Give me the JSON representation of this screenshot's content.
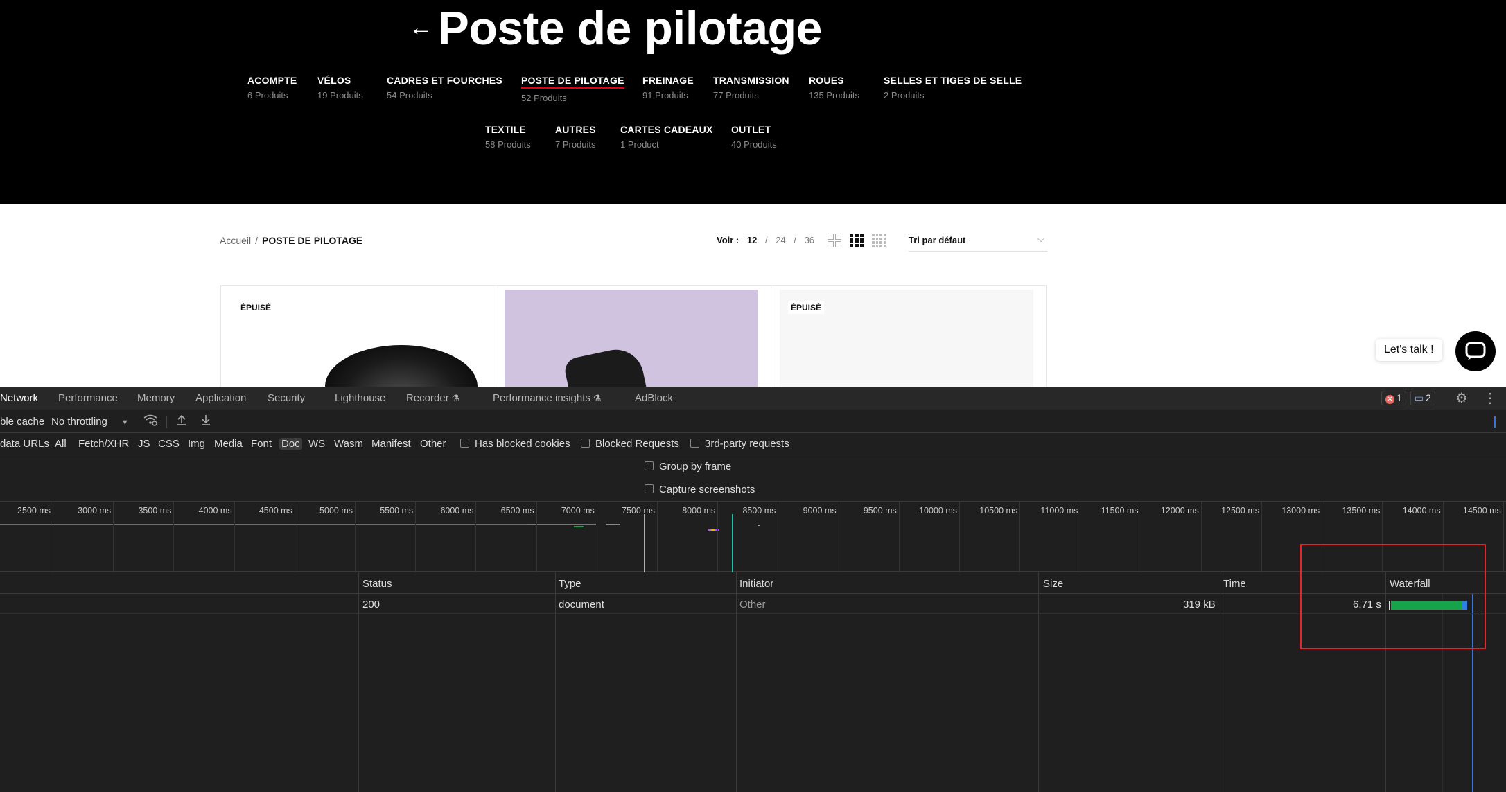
{
  "hero": {
    "back_arrow": "←",
    "title": "Poste de pilotage"
  },
  "categories": [
    {
      "name": "ACOMPTE",
      "count": "6 Produits",
      "active": false
    },
    {
      "name": "VÉLOS",
      "count": "19 Produits",
      "active": false
    },
    {
      "name": "CADRES ET FOURCHES",
      "count": "54 Produits",
      "active": false
    },
    {
      "name": "POSTE DE PILOTAGE",
      "count": "52 Produits",
      "active": true
    },
    {
      "name": "FREINAGE",
      "count": "91 Produits",
      "active": false
    },
    {
      "name": "TRANSMISSION",
      "count": "77 Produits",
      "active": false
    },
    {
      "name": "ROUES",
      "count": "135 Produits",
      "active": false
    },
    {
      "name": "SELLES ET TIGES DE SELLE",
      "count": "2 Produits",
      "active": false
    },
    {
      "name": "TEXTILE",
      "count": "58 Produits",
      "active": false
    },
    {
      "name": "AUTRES",
      "count": "7 Produits",
      "active": false
    },
    {
      "name": "CARTES CADEAUX",
      "count": "1 Product",
      "active": false
    },
    {
      "name": "OUTLET",
      "count": "40 Produits",
      "active": false
    }
  ],
  "breadcrumb": {
    "home": "Accueil",
    "separator": "/",
    "current": "POSTE DE PILOTAGE"
  },
  "per_page": {
    "label": "Voir :",
    "options": [
      "12",
      "24",
      "36"
    ],
    "selected": "12",
    "separator": "/"
  },
  "sort": {
    "value": "Tri par défaut",
    "chevron": "⌵"
  },
  "products": [
    {
      "badge": "ÉPUISÉ"
    },
    {
      "badge": ""
    },
    {
      "badge": "ÉPUISÉ"
    }
  ],
  "chat": {
    "label": "Let's talk !"
  },
  "devtools": {
    "tabs": [
      {
        "label": "Network",
        "active": true
      },
      {
        "label": "Performance",
        "active": false
      },
      {
        "label": "Memory",
        "active": false
      },
      {
        "label": "Application",
        "active": false
      },
      {
        "label": "Security",
        "active": false
      },
      {
        "label": "Lighthouse",
        "active": false
      },
      {
        "label": "Recorder",
        "active": false,
        "flask": true
      },
      {
        "label": "Performance insights",
        "active": false,
        "flask": true
      },
      {
        "label": "AdBlock",
        "active": false
      }
    ],
    "flask_icon": "⚗",
    "errors_count": "1",
    "messages_count": "2",
    "toolbar": {
      "disable_cache": "ble cache",
      "throttling": "No throttling",
      "throttle_arrow": "▼"
    },
    "filters": {
      "data_urls": "data URLs",
      "types": [
        "All",
        "Fetch/XHR",
        "JS",
        "CSS",
        "Img",
        "Media",
        "Font",
        "Doc",
        "WS",
        "Wasm",
        "Manifest",
        "Other"
      ],
      "active_type": "Doc",
      "checkboxes": [
        "Has blocked cookies",
        "Blocked Requests",
        "3rd-party requests"
      ]
    },
    "options": [
      "Group by frame",
      "Capture screenshots"
    ],
    "timeline_ticks": [
      "2500 ms",
      "3000 ms",
      "3500 ms",
      "4000 ms",
      "4500 ms",
      "5000 ms",
      "5500 ms",
      "6000 ms",
      "6500 ms",
      "7000 ms",
      "7500 ms",
      "8000 ms",
      "8500 ms",
      "9000 ms",
      "9500 ms",
      "10000 ms",
      "10500 ms",
      "11000 ms",
      "11500 ms",
      "12000 ms",
      "12500 ms",
      "13000 ms",
      "13500 ms",
      "14000 ms",
      "14500 ms"
    ],
    "columns": [
      "Status",
      "Type",
      "Initiator",
      "Size",
      "Time",
      "Waterfall"
    ],
    "rows": [
      {
        "status": "200",
        "type": "document",
        "initiator": "Other",
        "size": "319 kB",
        "time": "6.71 s"
      }
    ],
    "colors": {
      "dom_content_loaded": "#2f7fe0",
      "load": "#e3262b",
      "waterfall_bar": "#17a34a",
      "highlight": "#e3262b"
    }
  }
}
